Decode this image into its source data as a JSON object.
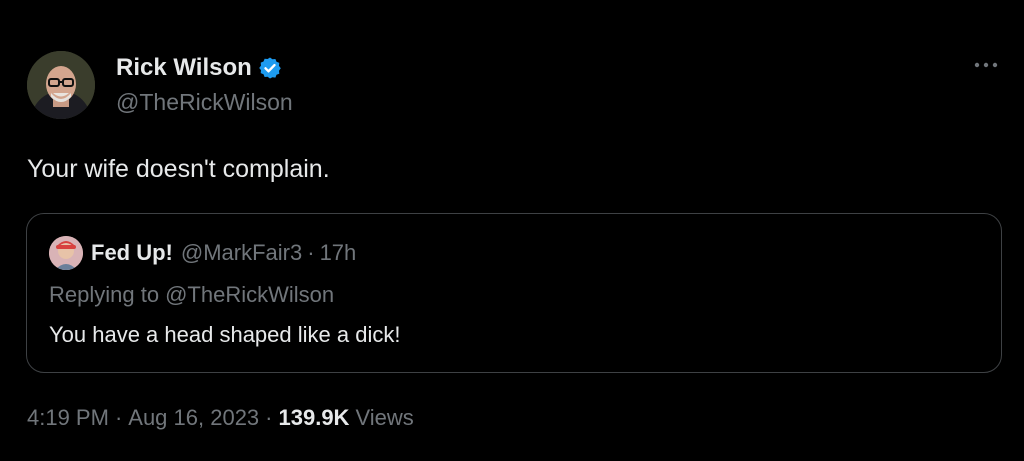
{
  "author": {
    "display_name": "Rick Wilson",
    "handle": "@TheRickWilson",
    "verified_icon": "verified-badge-icon",
    "avatar_icon": "avatar-photo"
  },
  "tweet": {
    "text": "Your wife doesn't complain."
  },
  "quoted_tweet": {
    "display_name": "Fed Up!",
    "handle": "@MarkFair3",
    "separator": "·",
    "time": "17h",
    "replying_label": "Replying to",
    "replying_handle": "@TheRickWilson",
    "text": "You have a head shaped like a dick!"
  },
  "meta": {
    "time": "4:19 PM",
    "separator": "·",
    "date": "Aug 16, 2023",
    "views_count": "139.9K",
    "views_label": "Views"
  },
  "colors": {
    "background": "#000000",
    "primary_text": "#e7e9ea",
    "secondary_text": "#71767b",
    "verified_blue": "#1d9bf0",
    "border": "#3e4144"
  },
  "icons": {
    "more": "more-options-icon"
  }
}
